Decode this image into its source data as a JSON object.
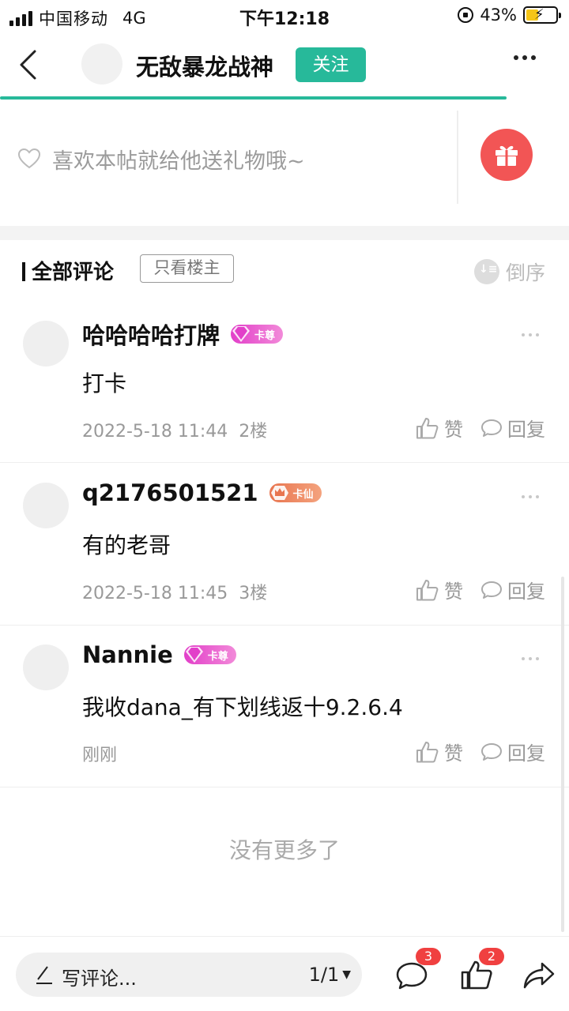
{
  "status_bar": {
    "carrier": "中国移动",
    "network": "4G",
    "time": "下午12:18",
    "battery_percent": "43%",
    "battery_level": 0.43,
    "battery_color": "#f5c518"
  },
  "navbar": {
    "title": "无敌暴龙战神",
    "follow_label": "关注",
    "accent_color": "#27b99a",
    "read_progress": 0.89
  },
  "gift": {
    "prompt": "喜欢本帖就给他送礼物哦~",
    "button_color": "#f25555"
  },
  "comments_header": {
    "title": "全部评论",
    "only_op_label": "只看楼主",
    "sort_label": "倒序"
  },
  "comments": [
    {
      "username": "哈哈哈哈打牌",
      "badge_text": "卡尊",
      "badge_style": "pink",
      "text": "打卡",
      "time": "2022-5-18 11:44",
      "floor": "2楼",
      "like_label": "赞",
      "reply_label": "回复"
    },
    {
      "username": "q2176501521",
      "badge_text": "卡仙",
      "badge_style": "orange",
      "text": "有的老哥",
      "time": "2022-5-18 11:45",
      "floor": "3楼",
      "like_label": "赞",
      "reply_label": "回复"
    },
    {
      "username": "Nannie",
      "badge_text": "卡尊",
      "badge_style": "pink",
      "text": "我收dana_有下划线返十9.2.6.4",
      "time": "刚刚",
      "floor": "",
      "like_label": "赞",
      "reply_label": "回复"
    }
  ],
  "no_more_text": "没有更多了",
  "bottom_bar": {
    "comment_placeholder": "写评论...",
    "page_indicator": "1/1",
    "comment_count": "3",
    "like_count": "2",
    "badge_color": "#f04040"
  }
}
